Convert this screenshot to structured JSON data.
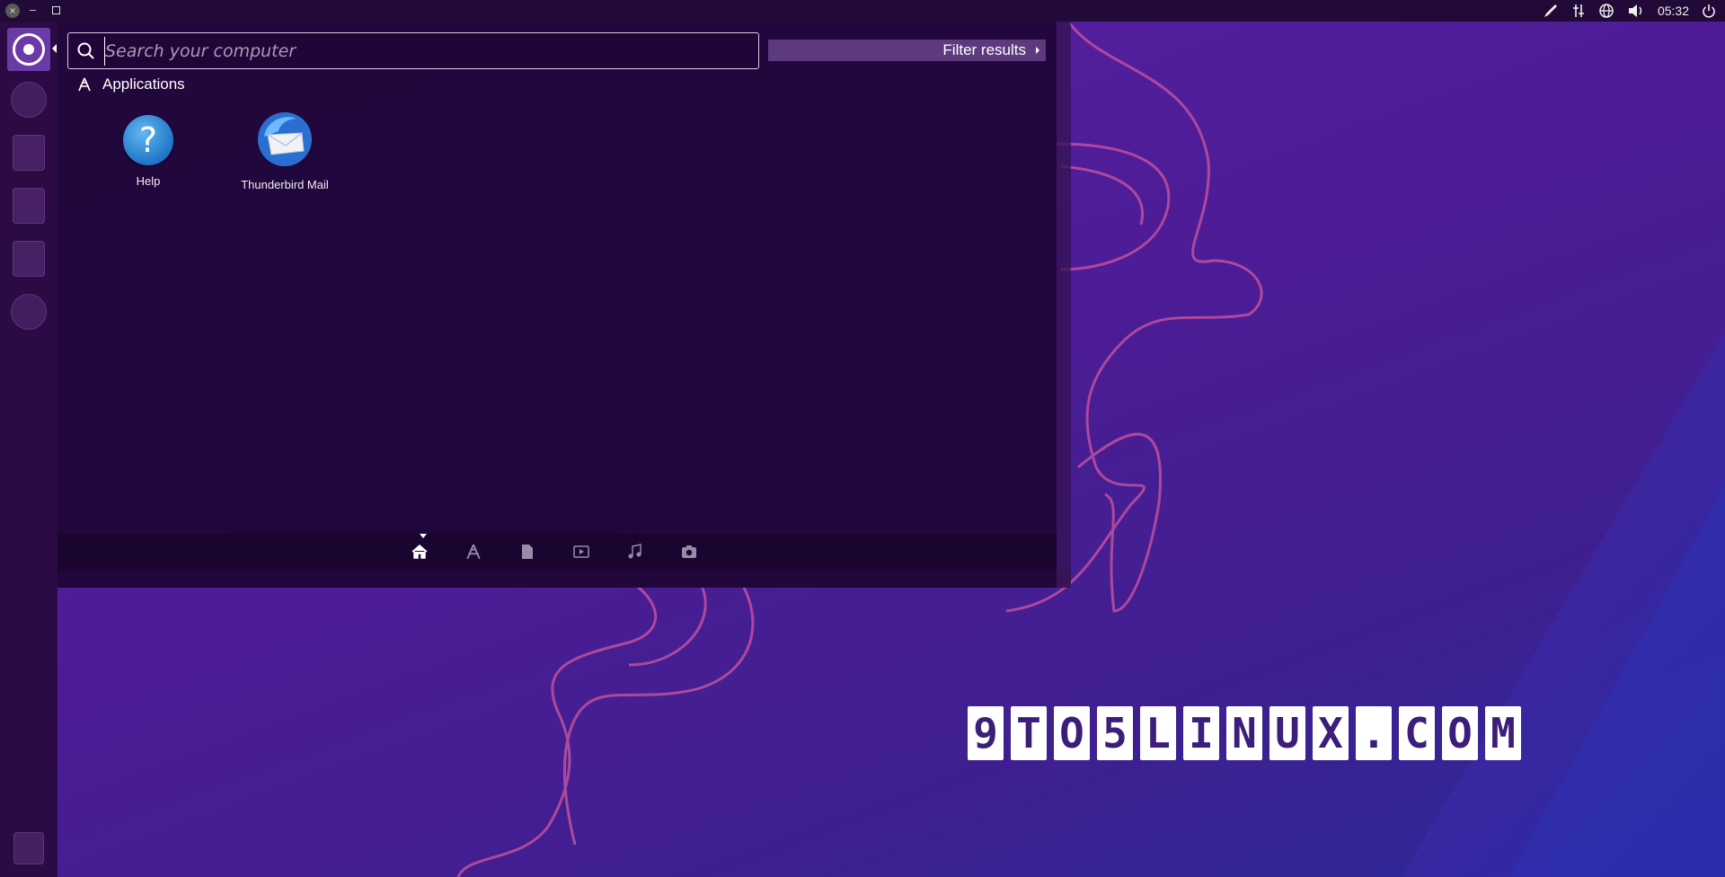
{
  "top_panel": {
    "clock": "05:32",
    "indicators": [
      "pen-icon",
      "network-icon",
      "globe-icon",
      "volume-icon",
      "power-icon"
    ]
  },
  "launcher": {
    "items": [
      "dash-home",
      "disk-usage",
      "writer",
      "calc",
      "impress",
      "settings",
      "trash"
    ]
  },
  "dash": {
    "search": {
      "value": "",
      "placeholder": "Search your computer"
    },
    "filter_label": "Filter results",
    "category": "Applications",
    "apps": [
      {
        "label": "Help"
      },
      {
        "label": "Thunderbird Mail"
      }
    ],
    "lenses": [
      "home-icon",
      "applications-icon",
      "files-icon",
      "video-icon",
      "music-icon",
      "photos-icon"
    ]
  },
  "watermark": {
    "chars": [
      "9",
      "T",
      "O",
      "5",
      "L",
      "I",
      "N",
      "U",
      "X",
      ".",
      "C",
      "O",
      "M"
    ]
  },
  "colors": {
    "panel": "#220a38",
    "dash_bg": "#20063a",
    "accent": "#6c3aa7"
  }
}
